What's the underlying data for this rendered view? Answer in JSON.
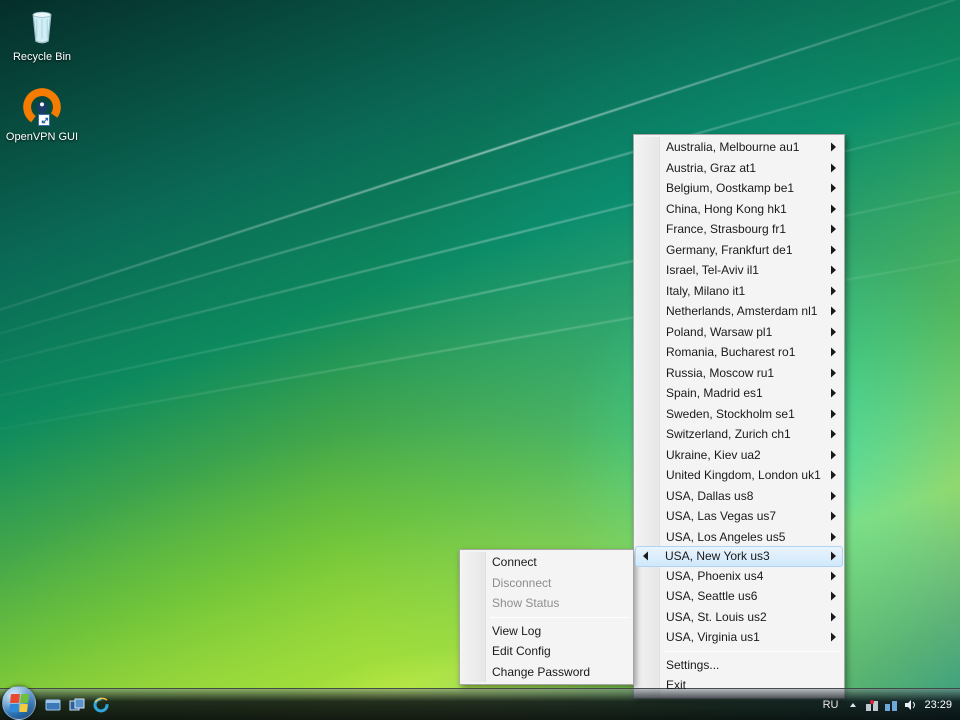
{
  "desktop_icons": {
    "recycle_bin": "Recycle Bin",
    "openvpn": "OpenVPN GUI"
  },
  "servers": [
    "Australia, Melbourne au1",
    "Austria, Graz at1",
    "Belgium, Oostkamp be1",
    "China, Hong Kong hk1",
    "France, Strasbourg fr1",
    "Germany, Frankfurt de1",
    "Israel, Tel-Aviv il1",
    "Italy, Milano it1",
    "Netherlands, Amsterdam nl1",
    "Poland, Warsaw pl1",
    "Romania, Bucharest ro1",
    "Russia, Moscow ru1",
    "Spain, Madrid es1",
    "Sweden, Stockholm se1",
    "Switzerland, Zurich ch1",
    "Ukraine, Kiev ua2",
    "United Kingdom, London uk1",
    "USA, Dallas us8",
    "USA, Las Vegas us7",
    "USA, Los Angeles us5",
    "USA, New York us3",
    "USA, Phoenix us4",
    "USA, Seattle us6",
    "USA, St. Louis us2",
    "USA, Virginia us1"
  ],
  "server_highlight_index": 20,
  "server_menu_footer": {
    "settings": "Settings...",
    "exit": "Exit"
  },
  "submenu": {
    "connect": "Connect",
    "disconnect": "Disconnect",
    "show_status": "Show Status",
    "view_log": "View Log",
    "edit_config": "Edit Config",
    "change_password": "Change Password"
  },
  "taskbar": {
    "language": "RU",
    "clock": "23:29"
  }
}
